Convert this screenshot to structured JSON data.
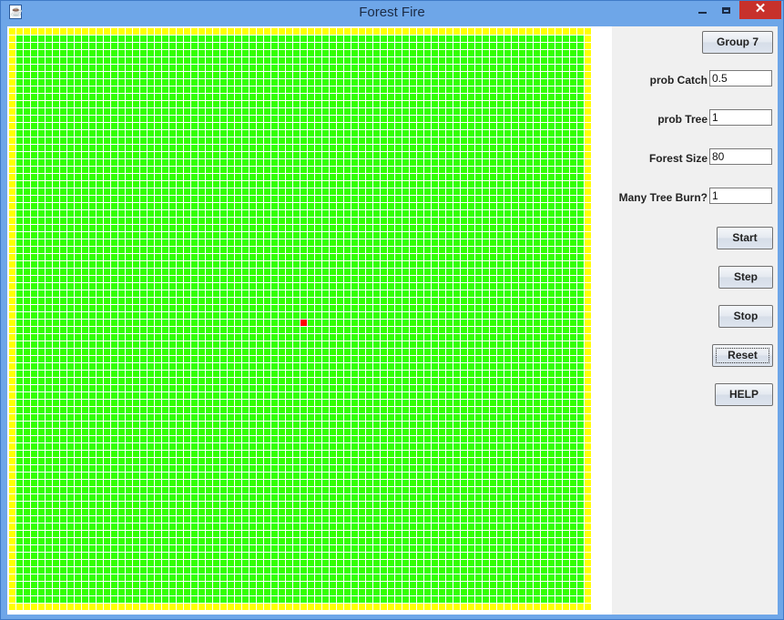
{
  "window": {
    "title": "Forest Fire",
    "controls": {
      "minimize": "minimize",
      "maximize": "maximize",
      "close": "✕"
    }
  },
  "icons": {
    "app": "java-cup-icon",
    "minimize": "minimize-icon",
    "maximize": "maximize-icon",
    "close": "close-icon"
  },
  "forest": {
    "grid_size": 80,
    "colors": {
      "border_cell": "#ffff00",
      "tree_cell": "#33ff00",
      "burning_cell": "#ff0000",
      "gap": "#ffffff"
    },
    "burning_cells": [
      [
        40,
        40
      ]
    ]
  },
  "panel": {
    "group_button": "Group 7",
    "fields": [
      {
        "label": "prob Catch",
        "value": "0.5"
      },
      {
        "label": "prob Tree",
        "value": "1"
      },
      {
        "label": "Forest Size",
        "value": "80"
      },
      {
        "label": "Many Tree Burn?",
        "value": "1"
      }
    ],
    "buttons": {
      "start": "Start",
      "step": "Step",
      "stop": "Stop",
      "reset": "Reset",
      "help": "HELP"
    }
  }
}
